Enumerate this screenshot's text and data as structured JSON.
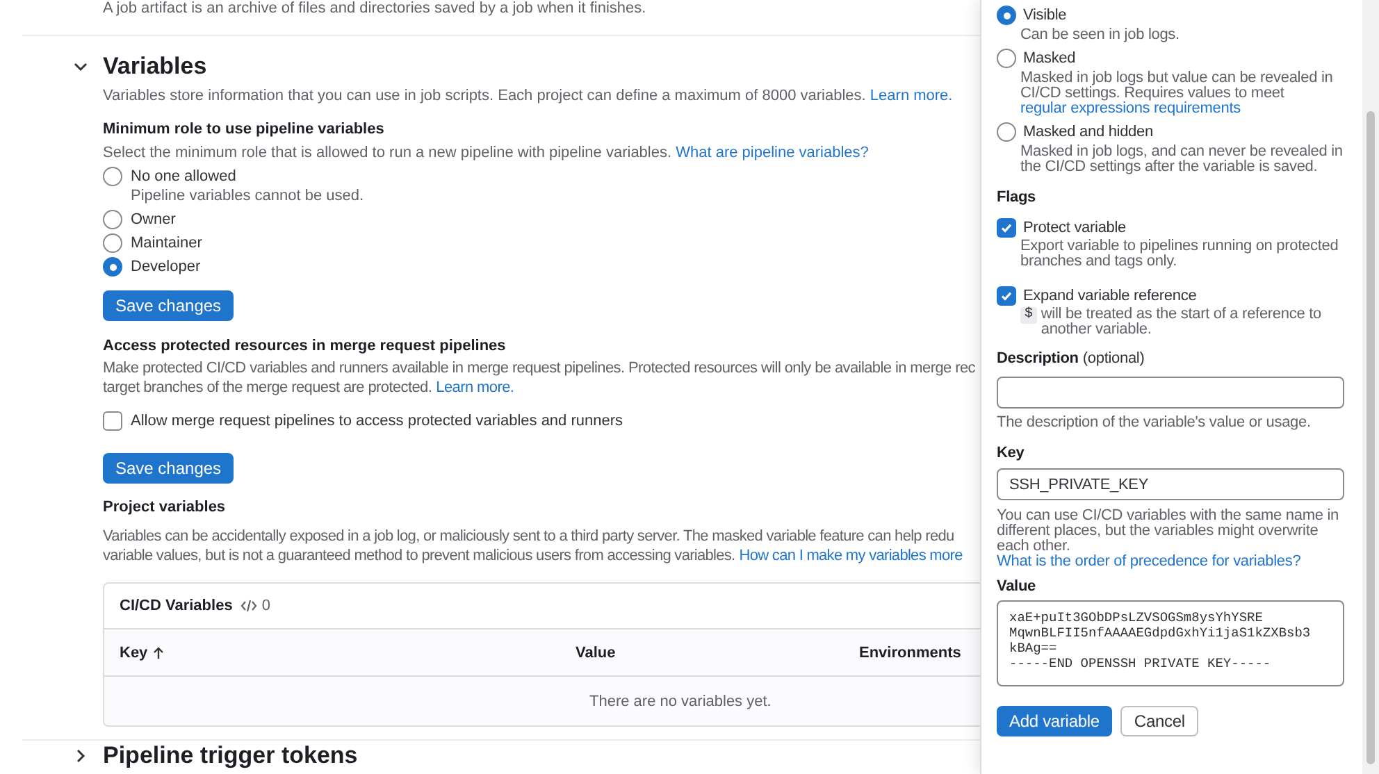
{
  "intro": "A job artifact is an archive of files and directories saved by a job when it finishes.",
  "section": {
    "title": "Variables",
    "expanded": true,
    "description": "Variables store information that you can use in job scripts. Each project can define a maximum of 8000 variables.",
    "link": "Learn more."
  },
  "min_role": {
    "title": "Minimum role to use pipeline variables",
    "description": "Select the minimum role that is allowed to run a new pipeline with pipeline variables.",
    "link": "What are pipeline variables?",
    "options": [
      {
        "label": "No one allowed",
        "help": "Pipeline variables cannot be used.",
        "selected": false
      },
      {
        "label": "Owner",
        "selected": false
      },
      {
        "label": "Maintainer",
        "selected": false
      },
      {
        "label": "Developer",
        "selected": true
      }
    ],
    "button": "Save changes"
  },
  "protected_access": {
    "title": "Access protected resources in merge request pipelines",
    "lines": [
      "Make protected CI/CD variables and runners available in merge request pipelines. Protected resources will only be available in merge rec",
      "target branches of the merge request are protected."
    ],
    "link": "Learn more.",
    "checkbox": {
      "label": "Allow merge request pipelines to access protected variables and runners",
      "checked": false
    },
    "button": "Save changes"
  },
  "project_variables": {
    "title": "Project variables",
    "lines": [
      "Variables can be accidentally exposed in a job log, or maliciously sent to a third party server. The masked variable feature can help redu",
      "variable values, but is not a guaranteed method to prevent malicious users from accessing variables."
    ],
    "link": "How can I make my variables more",
    "table": {
      "title": "CI/CD Variables",
      "count": "0",
      "columns": [
        "Key",
        "Value",
        "Environments"
      ],
      "empty": "There are no variables yet."
    }
  },
  "next_section": {
    "title": "Pipeline trigger tokens",
    "expanded": false
  },
  "drawer": {
    "visibility": [
      {
        "label": "Visible",
        "help": "Can be seen in job logs.",
        "selected": true
      },
      {
        "label": "Masked",
        "help": "Masked in job logs but value can be revealed in CI/CD settings. Requires values to meet",
        "link": "regular expressions requirements",
        "selected": false
      },
      {
        "label": "Masked and hidden",
        "help": "Masked in job logs, and can never be revealed in the CI/CD settings after the variable is saved.",
        "selected": false
      }
    ],
    "flags_title": "Flags",
    "flags": [
      {
        "label": "Protect variable",
        "help": "Export variable to pipelines running on protected branches and tags only.",
        "checked": true
      },
      {
        "label": "Expand variable reference",
        "code": "$",
        "help": "will be treated as the start of a reference to another variable.",
        "checked": true
      }
    ],
    "description": {
      "label": "Description",
      "optional": "(optional)",
      "help": "The description of the variable's value or usage."
    },
    "key": {
      "label": "Key",
      "value": "SSH_PRIVATE_KEY",
      "help": "You can use CI/CD variables with the same name in different places, but the variables might overwrite each other.",
      "link": "What is the order of precedence for variables?"
    },
    "value": {
      "label": "Value",
      "lines": [
        "xaE+puIt3GObDPsLZVSOGSm8ysYhYSRE",
        "MqwnBLFII5nfAAAAEGdpdGxhYi1jaS1kZXBsb3",
        "kBAg==",
        "-----END OPENSSH PRIVATE KEY-----"
      ]
    },
    "buttons": [
      "Add variable",
      "Cancel"
    ]
  }
}
